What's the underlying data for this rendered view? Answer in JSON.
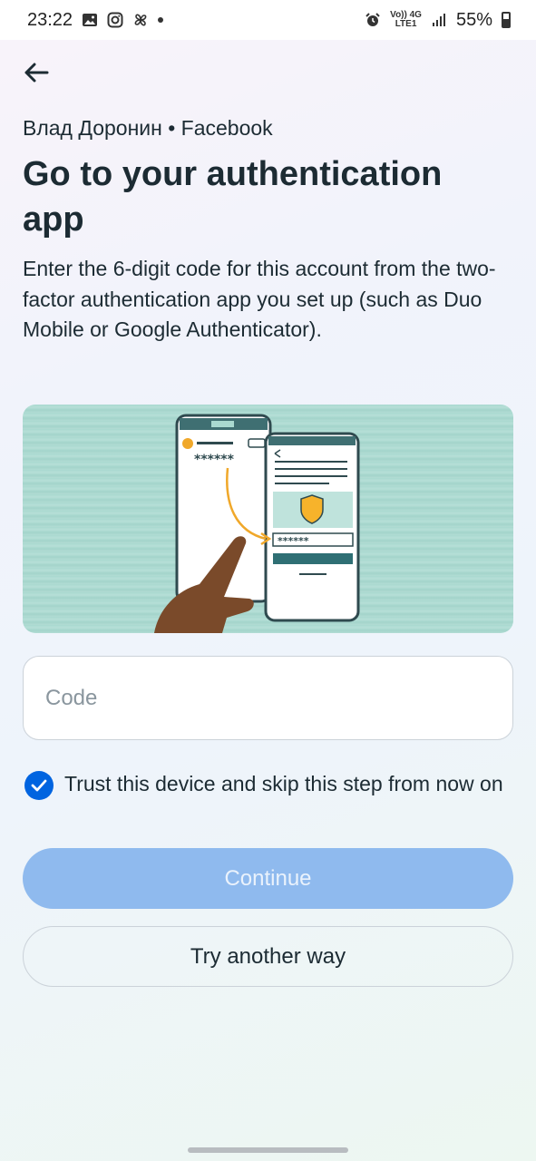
{
  "status_bar": {
    "time": "23:22",
    "network_top": "Vo)) 4G",
    "network_bottom": "LTE1",
    "battery": "55%",
    "icons": [
      "gallery-icon",
      "instagram-icon",
      "pinwheel-icon",
      "alarm-icon",
      "signal-icon",
      "battery-icon"
    ]
  },
  "header": {
    "back_icon": "arrow-left-icon",
    "account": "Влад Доронин • Facebook",
    "title": "Go to your authentication app",
    "description": "Enter the 6-digit code for this account from the two-factor authentication app you set up (such as Duo Mobile or Google Authenticator)."
  },
  "illustration": {
    "code_mask_left": "******",
    "code_mask_right": "******",
    "colors": {
      "background": "#a9d9d0",
      "phone_outline": "#2f4a4f",
      "accent": "#f0a82a",
      "hand": "#7a4a2a"
    }
  },
  "form": {
    "code_placeholder": "Code",
    "code_value": "",
    "trust_checked": true,
    "trust_label": "Trust this device and skip this step from now on",
    "continue_label": "Continue",
    "another_way_label": "Try another way"
  },
  "colors": {
    "primary": "#0064e0",
    "primary_disabled": "#8fbaee",
    "text": "#1c2b33",
    "border": "#cbd2d9"
  }
}
